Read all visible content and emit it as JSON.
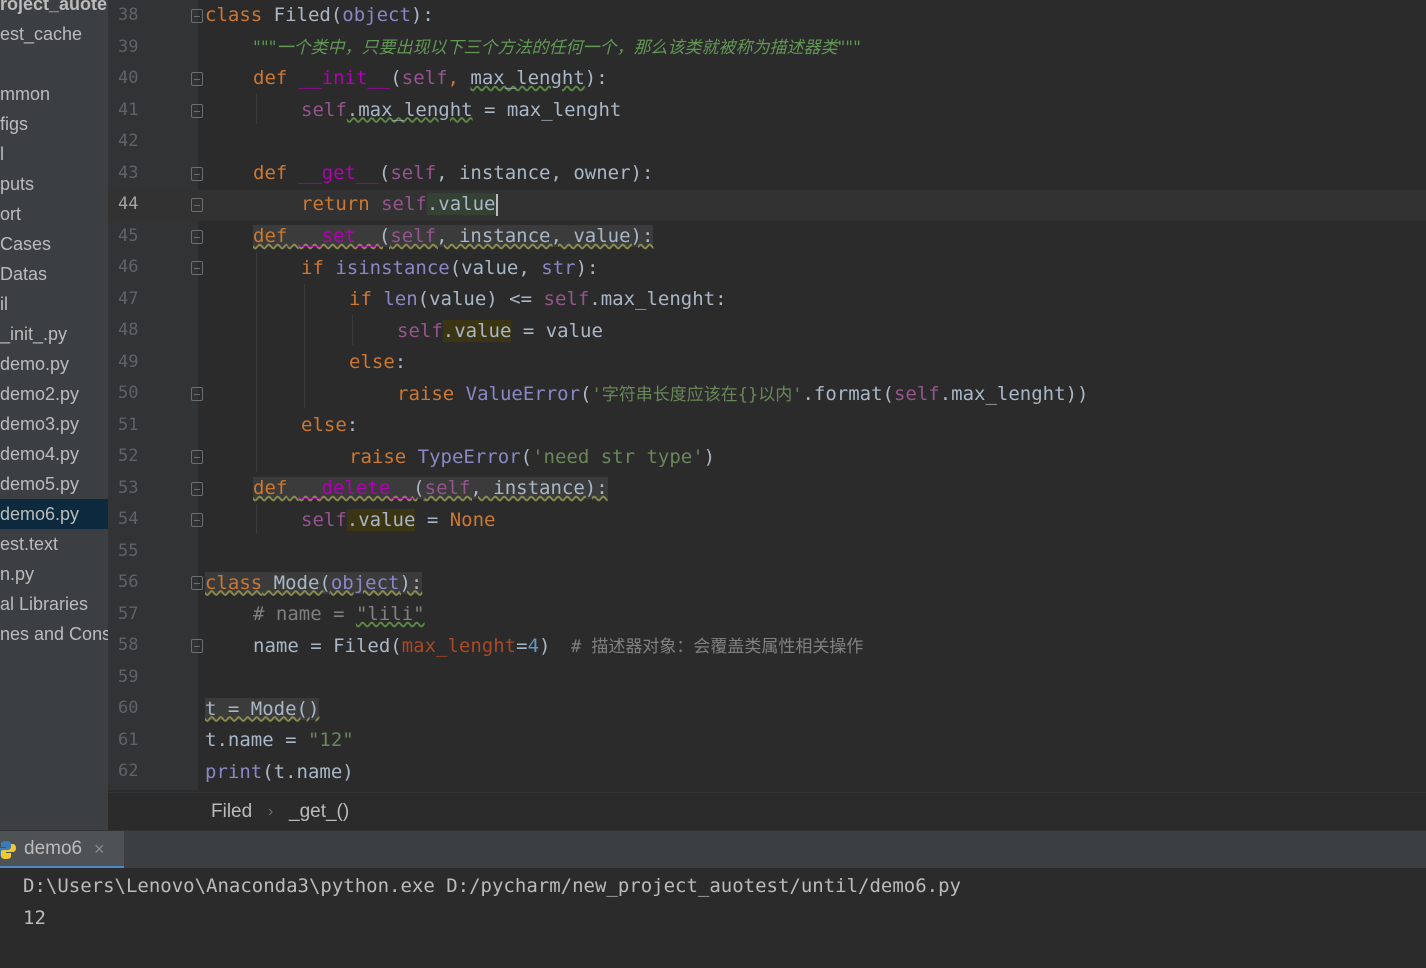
{
  "sidebar": {
    "items": [
      {
        "label": "roject_auote",
        "bold": true
      },
      {
        "label": "est_cache"
      },
      {
        "label": ""
      },
      {
        "label": "mmon"
      },
      {
        "label": "figs"
      },
      {
        "label": "l"
      },
      {
        "label": "puts"
      },
      {
        "label": "ort"
      },
      {
        "label": "Cases"
      },
      {
        "label": "Datas"
      },
      {
        "label": "il"
      },
      {
        "label": "_init_.py"
      },
      {
        "label": "demo.py"
      },
      {
        "label": "demo2.py"
      },
      {
        "label": "demo3.py"
      },
      {
        "label": "demo4.py"
      },
      {
        "label": "demo5.py"
      },
      {
        "label": "demo6.py",
        "selected": true
      },
      {
        "label": "est.text"
      },
      {
        "label": "n.py"
      },
      {
        "label": "al Libraries"
      },
      {
        "label": "nes and Cons"
      }
    ]
  },
  "editor": {
    "current_line": "44",
    "line_numbers": [
      "38",
      "39",
      "40",
      "41",
      "42",
      "43",
      "44",
      "45",
      "46",
      "47",
      "48",
      "49",
      "50",
      "51",
      "52",
      "53",
      "54",
      "55",
      "56",
      "57",
      "58",
      "59",
      "60",
      "61",
      "62"
    ],
    "code": {
      "l38": {
        "class_kw": "class",
        "name": " Filed(",
        "base": "object",
        "end": "):"
      },
      "l39": {
        "doc": "\"\"\"一个类中，只要出现以下三个方法的任何一个，那么该类就被称为描述器类\"\"\""
      },
      "l40": {
        "def_kw": "def",
        "fn": "__init__",
        "open": "(",
        "self": "self",
        "comma": ", ",
        "arg": "max_lenght",
        "end": "):"
      },
      "l41": {
        "self": "self",
        "attr": ".max_lenght",
        "rest": " = max_lenght"
      },
      "l43": {
        "def_kw": "def",
        "fn": "__get__",
        "open": "(",
        "self": "self",
        "rest": ", instance, owner):"
      },
      "l44": {
        "ret_kw": "return",
        "self": "self",
        "attr": ".value"
      },
      "l45": {
        "def_kw": "def",
        "fn": "__set__",
        "open": "(",
        "self": "self",
        "rest": ", instance, value):"
      },
      "l46": {
        "if_kw": "if",
        "builtin": "isinstance",
        "mid": "(value, ",
        "str_t": "str",
        "end": "):"
      },
      "l47": {
        "if_kw": "if",
        "builtin": "len",
        "mid": "(value) <= ",
        "self": "self",
        "rest": ".max_lenght:"
      },
      "l48": {
        "self": "self",
        "attr": ".value",
        "rest": " = value"
      },
      "l49": {
        "else_kw": "else",
        "colon": ":"
      },
      "l50": {
        "raise_kw": "raise",
        "exc": "ValueError",
        "open": "(",
        "str": "'字符串长度应该在{}以内'",
        "mid": ".format(",
        "self": "self",
        "rest": ".max_lenght))"
      },
      "l51": {
        "else_kw": "else",
        "colon": ":"
      },
      "l52": {
        "raise_kw": "raise",
        "exc": "TypeError",
        "open": "(",
        "str": "'need str type'",
        "end": ")"
      },
      "l53": {
        "def_kw": "def",
        "fn": "__delete__",
        "open": "(",
        "self": "self",
        "rest": ", instance):"
      },
      "l54": {
        "self": "self",
        "attr": ".value",
        "eq": " = ",
        "none": "None"
      },
      "l56": {
        "class_kw": "class",
        "name": " Mode(",
        "base": "object",
        "end": "):"
      },
      "l57": {
        "cmt_a": "# name = ",
        "cmt_b": "\"lili\""
      },
      "l58": {
        "lhs": "name = Filed(",
        "kwarg": "max_lenght",
        "eq": "=",
        "num": "4",
        "close": ")",
        "cmt": "  # 描述器对象：会覆盖类属性相关操作"
      },
      "l60": {
        "code": "t = Mode()"
      },
      "l61": {
        "lhs": "t.name = ",
        "str": "\"12\""
      },
      "l62": {
        "builtin": "print",
        "rest": "(t.name)"
      }
    }
  },
  "breadcrumb": {
    "class_name": "Filed",
    "separator": "›",
    "method": "_get_()"
  },
  "run": {
    "tab_label": "demo6",
    "close": "×",
    "console": [
      "D:\\Users\\Lenovo\\Anaconda3\\python.exe D:/pycharm/new_project_auotest/until/demo6.py",
      "12"
    ]
  },
  "colors": {
    "background": "#2b2b2b",
    "sidebar": "#3c3f41",
    "keyword": "#cc7832",
    "string": "#6a8759",
    "selection": "#0d293e"
  }
}
